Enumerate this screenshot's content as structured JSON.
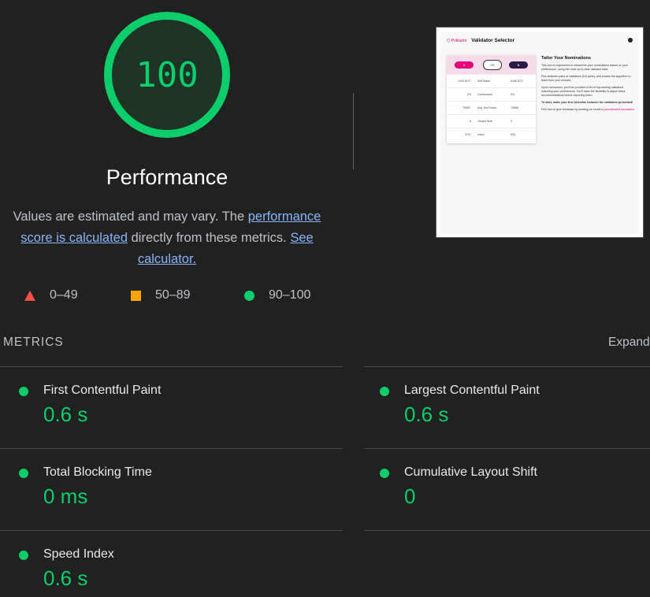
{
  "gauge": {
    "score": "100",
    "fraction": 1.0,
    "title": "Performance",
    "color": "#0cce6b"
  },
  "description": {
    "part1": "Values are estimated and may vary. The ",
    "link1": "performance score is calculated",
    "part2": " directly from these metrics. ",
    "link2": "See calculator."
  },
  "legend": [
    {
      "shape": "triangle",
      "label": "0–49",
      "color": "#ff4e42"
    },
    {
      "shape": "square",
      "label": "50–89",
      "color": "#ffa400"
    },
    {
      "shape": "circle",
      "label": "90–100",
      "color": "#0cce6b"
    }
  ],
  "screenshot": {
    "brand": "⬡ Polkadot",
    "title": "Validator Selector",
    "pill_a": "A",
    "pill_vs": "VS",
    "pill_b": "B",
    "rows": [
      {
        "left": "1000 DOT",
        "label": "Self Stake",
        "right": "6186 DOT"
      },
      {
        "left": "2%",
        "label": "Commission",
        "right": "5%"
      },
      {
        "left": "75380",
        "label": "Avg. Era Points",
        "right": "75686"
      },
      {
        "left": "6",
        "label": "Cluster Size",
        "right": "3"
      },
      {
        "left": "3707",
        "label": "Votes",
        "right": "934"
      }
    ],
    "heading": "Tailor Your Nominations",
    "para1": "This tool is engineered to streamline your nominations based on your preferences, using the most up-to-date validator data.",
    "para2": "Pick between pairs of validators (6-8 pairs), and enable the algorithm to learn from your choices.",
    "para3": "Upon conclusion, you'll be provided a list of top-ranking validators matching your preferences. You'll have the flexibility to adjust these recommendations before exporting them.",
    "para4": "To start, make your first selection between the validators presented!",
    "para5": "Feel free to give feedback by sending an email to",
    "email": "jonas@web3.foundation"
  },
  "metrics_header": {
    "label": "METRICS",
    "expand": "Expand view"
  },
  "metrics": [
    {
      "name": "First Contentful Paint",
      "value": "0.6 s"
    },
    {
      "name": "Largest Contentful Paint",
      "value": "0.6 s"
    },
    {
      "name": "Total Blocking Time",
      "value": "0 ms"
    },
    {
      "name": "Cumulative Layout Shift",
      "value": "0"
    },
    {
      "name": "Speed Index",
      "value": "0.6 s"
    }
  ]
}
